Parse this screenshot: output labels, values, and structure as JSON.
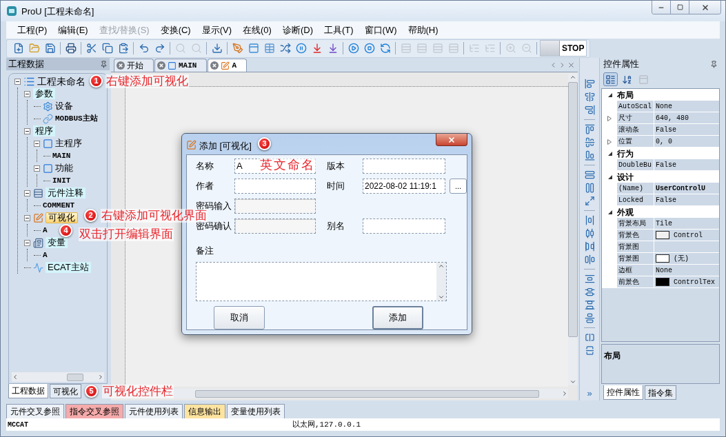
{
  "window": {
    "title": "ProU [工程未命名]"
  },
  "menu": [
    {
      "label": "工程(P)",
      "disabled": false
    },
    {
      "label": "编辑(E)",
      "disabled": false
    },
    {
      "label": "查找/替换(S)",
      "disabled": true
    },
    {
      "label": "变换(C)",
      "disabled": false
    },
    {
      "label": "显示(V)",
      "disabled": false
    },
    {
      "label": "在线(0)",
      "disabled": false
    },
    {
      "label": "诊断(D)",
      "disabled": false
    },
    {
      "label": "工具(T)",
      "disabled": false
    },
    {
      "label": "窗口(W)",
      "disabled": false
    },
    {
      "label": "帮助(H)",
      "disabled": false
    }
  ],
  "toolbar": [
    {
      "kind": "new",
      "disabled": false
    },
    {
      "kind": "open",
      "disabled": false
    },
    {
      "kind": "save",
      "disabled": false
    },
    {
      "kind": "separator"
    },
    {
      "kind": "print",
      "disabled": false
    },
    {
      "kind": "separator"
    },
    {
      "kind": "cut",
      "disabled": false
    },
    {
      "kind": "copy",
      "disabled": false
    },
    {
      "kind": "paste",
      "disabled": false
    },
    {
      "kind": "separator"
    },
    {
      "kind": "undo",
      "disabled": false
    },
    {
      "kind": "redo",
      "disabled": false
    },
    {
      "kind": "separator"
    },
    {
      "kind": "find",
      "disabled": true
    },
    {
      "kind": "find",
      "disabled": true
    },
    {
      "kind": "separator"
    },
    {
      "kind": "download",
      "disabled": false
    },
    {
      "kind": "separator"
    },
    {
      "kind": "compile",
      "disabled": false
    },
    {
      "kind": "window",
      "disabled": false
    },
    {
      "kind": "table",
      "disabled": false
    },
    {
      "kind": "shuffle",
      "disabled": false
    },
    {
      "kind": "pause",
      "disabled": false
    },
    {
      "kind": "download_red",
      "disabled": false
    },
    {
      "kind": "download_purple",
      "disabled": false
    },
    {
      "kind": "separator"
    },
    {
      "kind": "run",
      "disabled": false
    },
    {
      "kind": "stop",
      "disabled": false
    },
    {
      "kind": "reset",
      "disabled": false
    },
    {
      "kind": "separator"
    },
    {
      "kind": "rung",
      "disabled": true
    },
    {
      "kind": "rung",
      "disabled": true
    },
    {
      "kind": "rung",
      "disabled": true
    },
    {
      "kind": "rung",
      "disabled": true
    },
    {
      "kind": "separator"
    },
    {
      "kind": "insert",
      "disabled": true
    },
    {
      "kind": "insert",
      "disabled": true
    },
    {
      "kind": "separator"
    },
    {
      "kind": "zoom_in",
      "disabled": true
    },
    {
      "kind": "zoom_out",
      "disabled": true
    },
    {
      "kind": "separator"
    },
    {
      "kind": "status",
      "label": "STOP"
    }
  ],
  "left_panel": {
    "title": "工程数据",
    "tree": [
      {
        "label": "工程未命名",
        "kind": "root",
        "expanded": true,
        "selected": false,
        "children": [
          {
            "label": "参数",
            "kind": "folder",
            "expanded": true,
            "selected": false,
            "children": [
              {
                "label": "设备",
                "kind": "device",
                "selected": false
              },
              {
                "label": "MODBUS主站",
                "kind": "link",
                "selected": false
              }
            ]
          },
          {
            "label": "程序",
            "kind": "folder",
            "expanded": true,
            "selected": false,
            "children": [
              {
                "label": "主程序",
                "kind": "program",
                "expanded": true,
                "selected": false,
                "children": [
                  {
                    "label": "MAIN",
                    "kind": "leaf",
                    "selected": false
                  }
                ]
              },
              {
                "label": "功能",
                "kind": "program",
                "expanded": true,
                "selected": false,
                "children": [
                  {
                    "label": "INIT",
                    "kind": "leaf",
                    "selected": false
                  }
                ]
              }
            ]
          },
          {
            "label": "元件注释",
            "kind": "comment",
            "expanded": true,
            "selected": false,
            "children": [
              {
                "label": "COMMENT",
                "kind": "leaf",
                "selected": false
              }
            ]
          },
          {
            "label": "可视化",
            "kind": "visual",
            "expanded": true,
            "selected": true,
            "children": [
              {
                "label": "A",
                "kind": "leaf",
                "selected": false
              }
            ]
          },
          {
            "label": "变量",
            "kind": "variable",
            "expanded": true,
            "selected": false,
            "children": [
              {
                "label": "A",
                "kind": "leaf",
                "selected": false
              }
            ]
          },
          {
            "label": "ECAT主站",
            "kind": "ecat",
            "selected": false
          }
        ]
      }
    ],
    "tabs": [
      {
        "label": "工程数据",
        "selected": true
      },
      {
        "label": "可视化",
        "selected": false
      }
    ]
  },
  "doc_tabs": [
    {
      "label": "开始",
      "kind": "start",
      "selected": false
    },
    {
      "label": "MAIN",
      "kind": "program",
      "selected": false
    },
    {
      "label": "A",
      "kind": "visual",
      "selected": true
    }
  ],
  "dialog": {
    "title": "添加 [可视化]",
    "rows": [
      [
        {
          "label": "名称",
          "kind": "text",
          "value": "A"
        },
        {
          "label": "版本",
          "kind": "text"
        }
      ],
      [
        {
          "label": "作者",
          "kind": "text"
        },
        {
          "label": "时间",
          "kind": "date",
          "value": "2022-08-02 11:19:1",
          "browse": "..."
        }
      ],
      [
        {
          "label": "密码输入",
          "kind": "password"
        }
      ],
      [
        {
          "label": "密码确认",
          "kind": "password"
        },
        {
          "label": "别名",
          "kind": "text"
        }
      ]
    ],
    "notes_label": "备注",
    "buttons": [
      {
        "label": "取消",
        "default": false
      },
      {
        "label": "添加",
        "default": true
      }
    ]
  },
  "annotations": [
    {
      "number": "1",
      "text": "右键添加可视化"
    },
    {
      "number": "2",
      "text": "右键添加可视化界面"
    },
    {
      "number": "3"
    },
    {
      "text": "英文命名"
    },
    {
      "number": "4",
      "text": "双击打开编辑界面"
    },
    {
      "number": "5",
      "text": "可视化控件栏"
    }
  ],
  "vertical_toolbar": {
    "overflow": "»"
  },
  "right_panel": {
    "title": "控件属性",
    "toolbar": [
      {
        "kind": "categorized",
        "selected": true,
        "disabled": false
      },
      {
        "kind": "alphabetical",
        "selected": false,
        "disabled": false
      },
      {
        "kind": "pages",
        "selected": false,
        "disabled": true
      }
    ],
    "categories": [
      {
        "name": "布局",
        "expanded": true,
        "properties": [
          {
            "name": "AutoScal",
            "value": "None",
            "expandable": false,
            "bold": false
          },
          {
            "name": "尺寸",
            "value": "640, 480",
            "expandable": true,
            "bold": false
          },
          {
            "name": "滚动条",
            "value": "False",
            "expandable": false,
            "bold": false
          },
          {
            "name": "位置",
            "value": "0, 0",
            "expandable": true,
            "bold": false
          }
        ]
      },
      {
        "name": "行为",
        "expanded": true,
        "properties": [
          {
            "name": "DoubleBu",
            "value": "False",
            "expandable": false,
            "bold": false
          }
        ]
      },
      {
        "name": "设计",
        "expanded": true,
        "properties": [
          {
            "name": "(Name)",
            "value": "UserControlU",
            "expandable": false,
            "bold": true
          },
          {
            "name": "Locked",
            "value": "False",
            "expandable": false,
            "bold": false
          }
        ]
      },
      {
        "name": "外观",
        "expanded": true,
        "properties": [
          {
            "name": "背景布局",
            "value": "Tile",
            "expandable": false,
            "bold": false
          },
          {
            "name": "背景色",
            "value": "Control",
            "color": "#f0f0f0",
            "expandable": false,
            "bold": false
          },
          {
            "name": "背景图",
            "expandable": false
          },
          {
            "name": "背景图",
            "value": "(无)",
            "color": "#ffffff",
            "expandable": false,
            "bold": false
          },
          {
            "name": "边框",
            "value": "None",
            "expandable": false,
            "bold": false
          },
          {
            "name": "前景色",
            "value": "ControlTex",
            "color": "#000000",
            "expandable": false,
            "bold": false
          }
        ]
      }
    ],
    "description": "布局",
    "tabs": [
      {
        "label": "控件属性",
        "selected": true
      },
      {
        "label": "指令集",
        "selected": false
      }
    ]
  },
  "bottom_tabs": [
    {
      "label": "元件交叉参照",
      "color": "#edf2f8"
    },
    {
      "label": "指令交叉参照",
      "color": "#f5abab"
    },
    {
      "label": "元件使用列表",
      "color": "#edf2f8"
    },
    {
      "label": "信息输出",
      "color": "#fde3a0"
    },
    {
      "label": "变量使用列表",
      "color": "#edf2f8"
    }
  ],
  "status_bar": {
    "left": "MCCAT",
    "center": "以太网,127.0.0.1"
  }
}
